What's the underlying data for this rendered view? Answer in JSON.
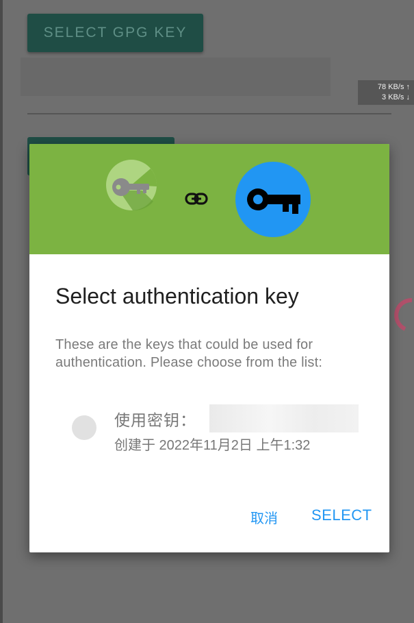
{
  "background": {
    "button_label": "SELECT GPG KEY",
    "net_speed_up": "78 KB/s ↑",
    "net_speed_down": "3 KB/s ↓"
  },
  "dialog": {
    "title": "Select authentication key",
    "message": "These are the keys that could be used for authentication. Please choose from the list:",
    "option": {
      "label": "使用密钥：",
      "created": "创建于 2022年11月2日 上午1:32",
      "selected": false
    },
    "cancel_label": "取消",
    "select_label": "SELECT",
    "icons": [
      "app-key-icon",
      "link-icon",
      "key-icon"
    ],
    "colors": {
      "header": "#7cb342",
      "accent": "#2196f3",
      "key_circle": "#2196f3"
    }
  }
}
